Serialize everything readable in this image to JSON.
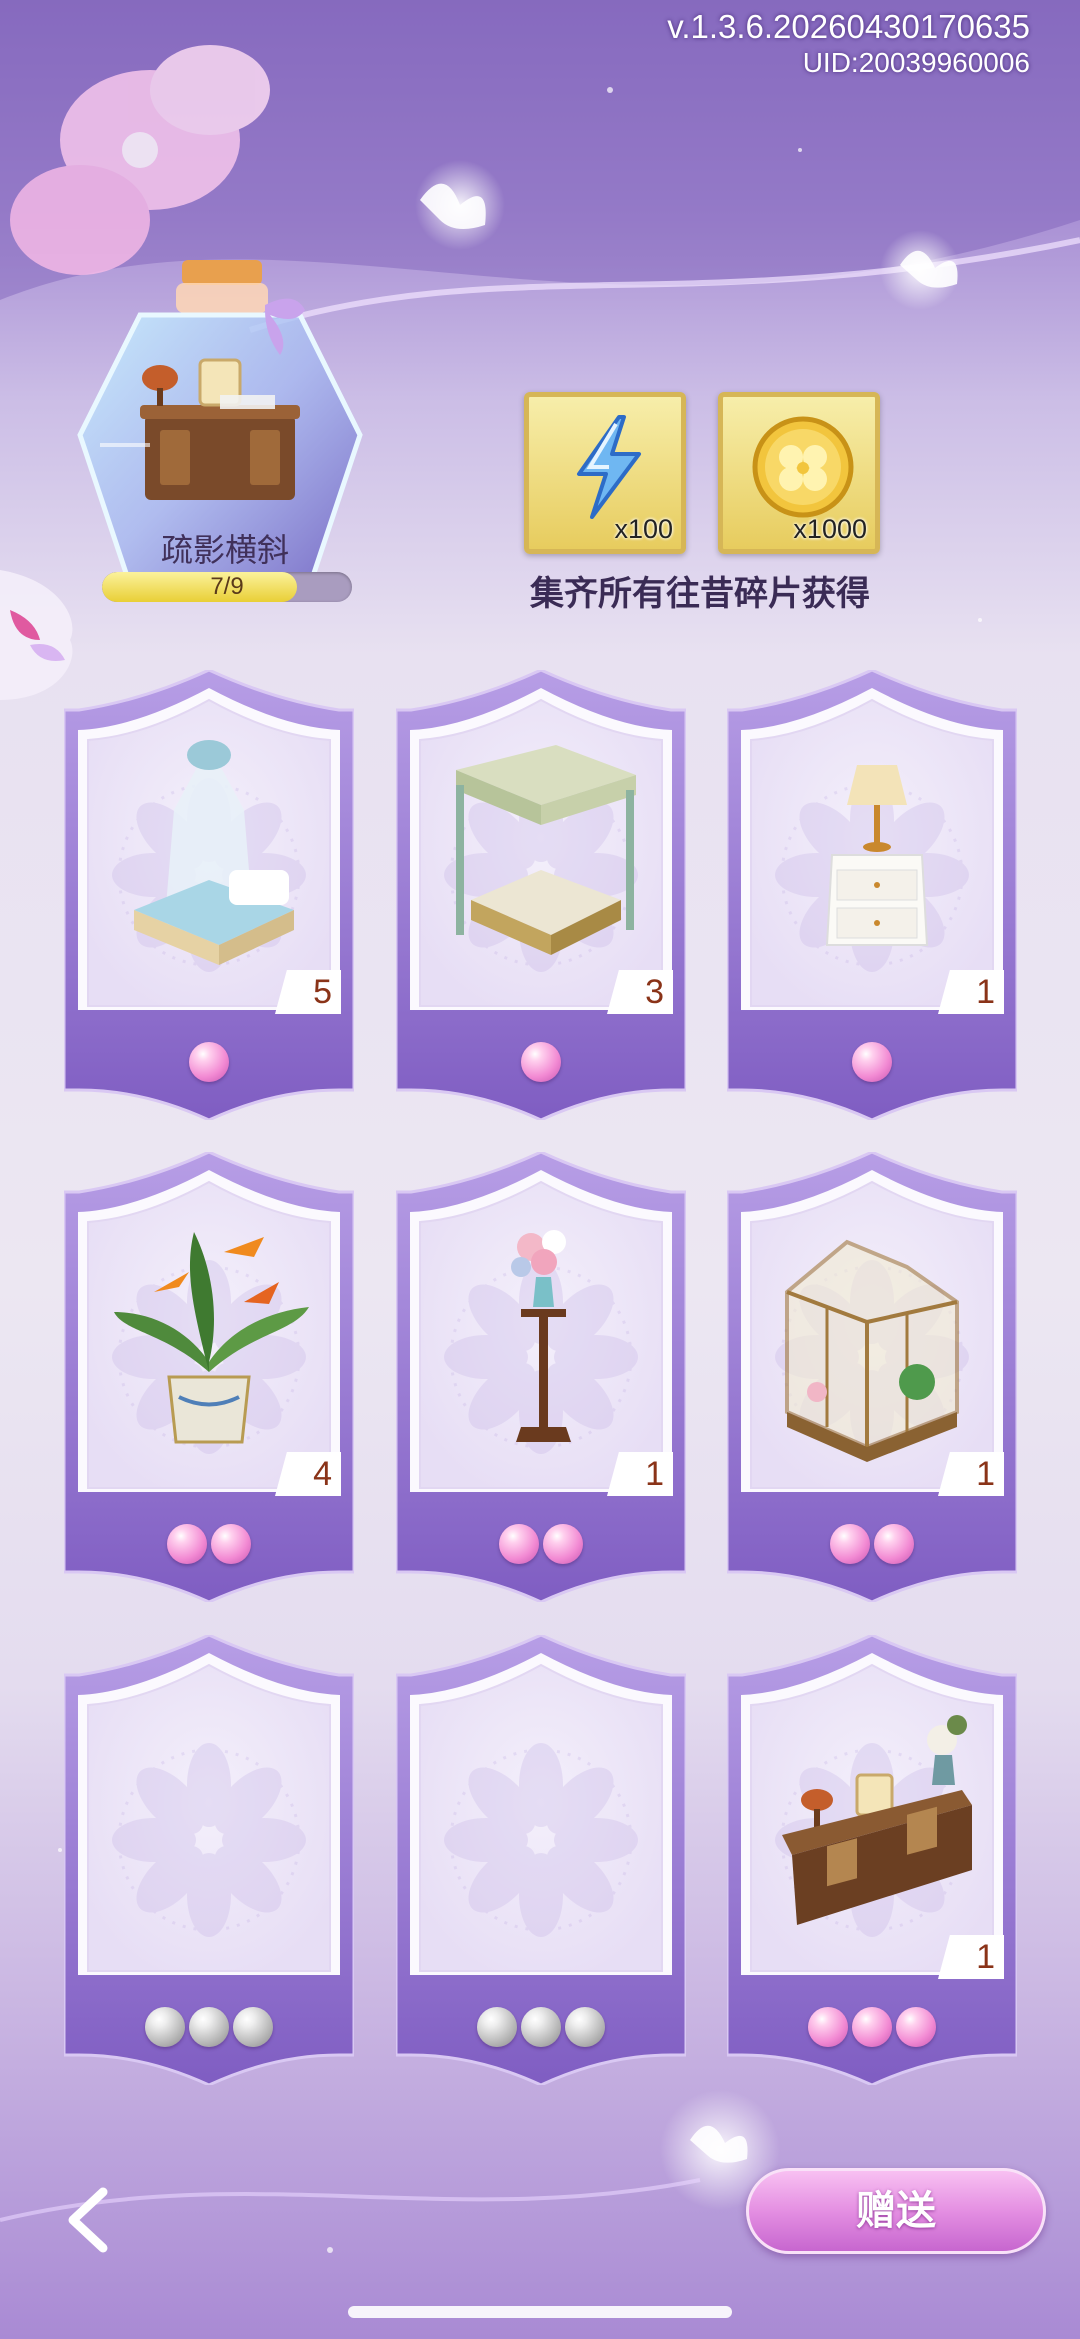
{
  "header": {
    "version": "v.1.3.6.20260430170635",
    "uid": "UID:20039960006"
  },
  "collection": {
    "name": "疏影横斜",
    "progress_text": "7/9",
    "progress_fraction": 0.78
  },
  "rewards": {
    "items": [
      {
        "icon": "lightning-icon",
        "quantity": "x100"
      },
      {
        "icon": "clover-coin-icon",
        "quantity": "x1000"
      }
    ],
    "caption": "集齐所有往昔碎片获得"
  },
  "cards": [
    {
      "item": "canopy-bed-blue",
      "count": "5",
      "pearls": 1,
      "collected": true
    },
    {
      "item": "canopy-bed-floral",
      "count": "3",
      "pearls": 1,
      "collected": true
    },
    {
      "item": "nightstand-with-lamp",
      "count": "1",
      "pearls": 1,
      "collected": true
    },
    {
      "item": "bird-of-paradise-plant",
      "count": "4",
      "pearls": 2,
      "collected": true
    },
    {
      "item": "flower-vase-stand",
      "count": "1",
      "pearls": 2,
      "collected": true
    },
    {
      "item": "glass-greenhouse",
      "count": "1",
      "pearls": 2,
      "collected": true
    },
    {
      "item": "empty-slot",
      "count": "",
      "pearls": 3,
      "collected": false
    },
    {
      "item": "empty-slot",
      "count": "",
      "pearls": 3,
      "collected": false
    },
    {
      "item": "writing-desk",
      "count": "1",
      "pearls": 3,
      "collected": true
    }
  ],
  "footer": {
    "gift_label": "赠送"
  },
  "colors": {
    "accent": "#c766cf",
    "card_frame": "#8d6cc9",
    "pearl_pink": "#f28ad3",
    "pearl_grey": "#bbbbbb",
    "reward_bg": "#efdb83"
  }
}
